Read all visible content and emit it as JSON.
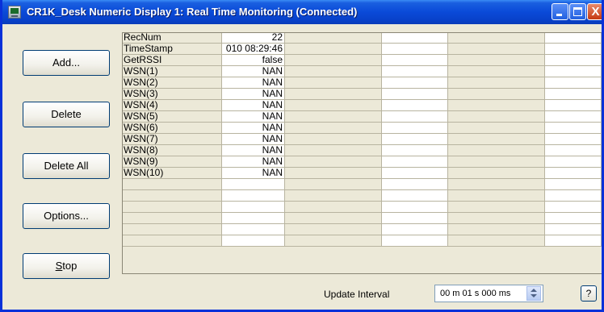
{
  "window": {
    "title": "CR1K_Desk Numeric Display 1: Real Time Monitoring (Connected)",
    "close_glyph": "X"
  },
  "buttons": {
    "add": "Add...",
    "delete": "Delete",
    "delete_all": "Delete All",
    "options": "Options...",
    "stop_mnemonic": "S",
    "stop_rest": "top"
  },
  "table": {
    "rows": [
      {
        "label": "RecNum",
        "value": "22"
      },
      {
        "label": "TimeStamp",
        "value": "010 08:29:46"
      },
      {
        "label": "GetRSSI",
        "value": "false"
      },
      {
        "label": "WSN(1)",
        "value": "NAN"
      },
      {
        "label": "WSN(2)",
        "value": "NAN"
      },
      {
        "label": "WSN(3)",
        "value": "NAN"
      },
      {
        "label": "WSN(4)",
        "value": "NAN"
      },
      {
        "label": "WSN(5)",
        "value": "NAN"
      },
      {
        "label": "WSN(6)",
        "value": "NAN"
      },
      {
        "label": "WSN(7)",
        "value": "NAN"
      },
      {
        "label": "WSN(8)",
        "value": "NAN"
      },
      {
        "label": "WSN(9)",
        "value": "NAN"
      },
      {
        "label": "WSN(10)",
        "value": "NAN"
      },
      {
        "label": "",
        "value": ""
      },
      {
        "label": "",
        "value": ""
      },
      {
        "label": "",
        "value": ""
      },
      {
        "label": "",
        "value": ""
      },
      {
        "label": "",
        "value": ""
      },
      {
        "label": "",
        "value": ""
      }
    ]
  },
  "footer": {
    "update_interval_label": "Update Interval",
    "update_interval_value": "00 m 01 s 000 ms",
    "help_label": "?"
  },
  "icons": [
    "app-icon",
    "minimize-icon",
    "maximize-icon",
    "close-icon",
    "spin-up-icon",
    "spin-down-icon"
  ]
}
